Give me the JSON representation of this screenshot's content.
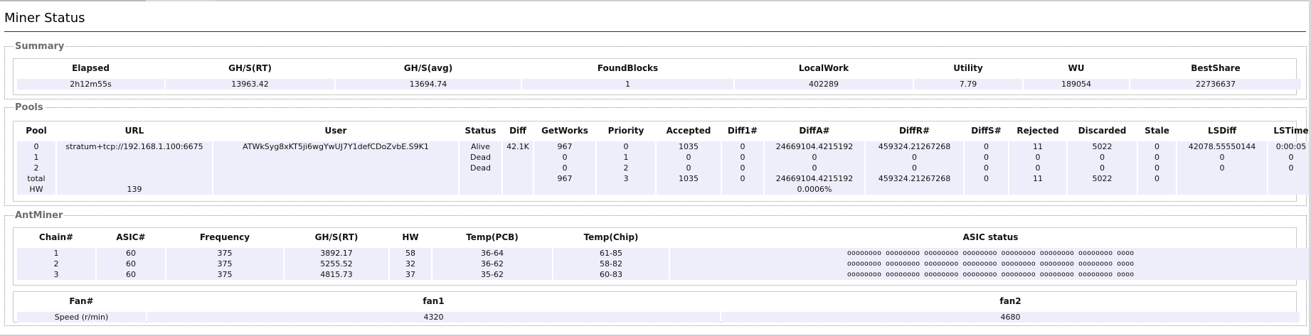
{
  "page": {
    "title": "Miner Status"
  },
  "summary": {
    "legend": "Summary",
    "headers": [
      "Elapsed",
      "GH/S(RT)",
      "GH/S(avg)",
      "FoundBlocks",
      "LocalWork",
      "Utility",
      "WU",
      "BestShare"
    ],
    "row": [
      "2h12m55s",
      "13963.42",
      "13694.74",
      "1",
      "402289",
      "7.79",
      "189054",
      "22736637"
    ]
  },
  "pools": {
    "legend": "Pools",
    "headers": [
      "Pool",
      "URL",
      "User",
      "Status",
      "Diff",
      "GetWorks",
      "Priority",
      "Accepted",
      "Diff1#",
      "DiffA#",
      "DiffR#",
      "DiffS#",
      "Rejected",
      "Discarded",
      "Stale",
      "LSDiff",
      "LSTime"
    ],
    "rows": [
      [
        "0",
        "stratum+tcp://192.168.1.100:6675",
        "ATWkSyg8xKT5ji6wgYwUJ7Y1defCDoZvbE.S9K1",
        "Alive",
        "42.1K",
        "967",
        "0",
        "1035",
        "0",
        "24669104.4215192",
        "459324.21267268",
        "0",
        "11",
        "5022",
        "0",
        "42078.55550144",
        "0:00:05"
      ],
      [
        "1",
        "",
        "",
        "Dead",
        "",
        "0",
        "1",
        "0",
        "0",
        "0",
        "0",
        "0",
        "0",
        "0",
        "0",
        "0",
        "0"
      ],
      [
        "2",
        "",
        "",
        "Dead",
        "",
        "0",
        "2",
        "0",
        "0",
        "0",
        "0",
        "0",
        "0",
        "0",
        "0",
        "0",
        "0"
      ],
      [
        "total",
        "",
        "",
        "",
        "",
        "967",
        "3",
        "1035",
        "0",
        "24669104.4215192",
        "459324.21267268",
        "0",
        "11",
        "5022",
        "0",
        "",
        ""
      ],
      [
        "HW",
        "139",
        "",
        "",
        "",
        "",
        "",
        "",
        "",
        "0.0006%",
        "",
        "",
        "",
        "",
        "",
        "",
        ""
      ]
    ]
  },
  "antminer": {
    "legend": "AntMiner",
    "chain_headers": [
      "Chain#",
      "ASIC#",
      "Frequency",
      "GH/S(RT)",
      "HW",
      "Temp(PCB)",
      "Temp(Chip)",
      "ASIC status"
    ],
    "chains": [
      [
        "1",
        "60",
        "375",
        "3892.17",
        "58",
        "36-64",
        "61-85",
        "oooooooo oooooooo oooooooo oooooooo oooooooo oooooooo oooooooo oooo"
      ],
      [
        "2",
        "60",
        "375",
        "5255.52",
        "32",
        "36-62",
        "58-82",
        "oooooooo oooooooo oooooooo oooooooo oooooooo oooooooo oooooooo oooo"
      ],
      [
        "3",
        "60",
        "375",
        "4815.73",
        "37",
        "35-62",
        "60-83",
        "oooooooo oooooooo oooooooo oooooooo oooooooo oooooooo oooooooo oooo"
      ]
    ],
    "fan_headers": [
      "Fan#",
      "fan1",
      "fan2"
    ],
    "fan_row": [
      "Speed (r/min)",
      "4320",
      "4680"
    ]
  },
  "colors": {
    "cell_bg": "#eeeefb",
    "legend_text": "#6c6c6c",
    "border": "#c9c9c9"
  }
}
